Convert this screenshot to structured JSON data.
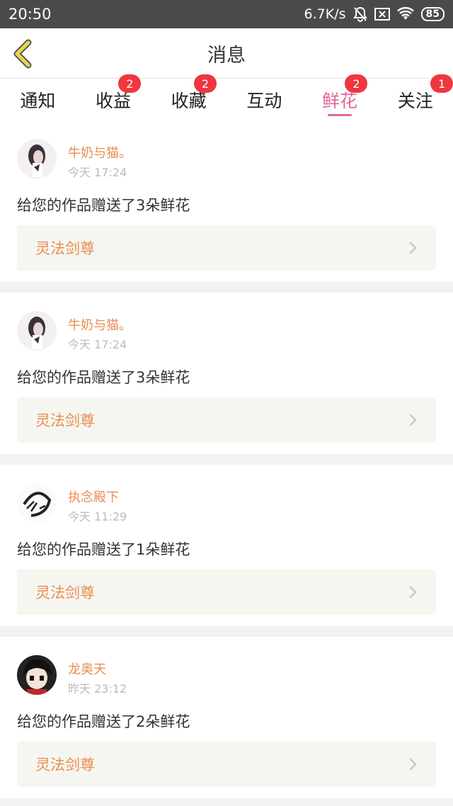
{
  "status_bar": {
    "time": "20:50",
    "network_speed": "6.7K/s",
    "battery": "85",
    "icons": [
      "mute-bell-icon",
      "sim-x-icon",
      "wifi-icon",
      "battery-icon"
    ]
  },
  "header": {
    "title": "消息",
    "back_icon": "chevron-left-icon"
  },
  "tabs": [
    {
      "label": "通知",
      "badge": ""
    },
    {
      "label": "收益",
      "badge": "2"
    },
    {
      "label": "收藏",
      "badge": "2"
    },
    {
      "label": "互动",
      "badge": ""
    },
    {
      "label": "鲜花",
      "badge": "2",
      "active": true
    },
    {
      "label": "关注",
      "badge": "1"
    }
  ],
  "messages": [
    {
      "user": "牛奶与猫。",
      "time": "今天 17:24",
      "text": "给您的作品赠送了3朵鲜花",
      "work": "灵法剑尊"
    },
    {
      "user": "牛奶与猫。",
      "time": "今天 17:24",
      "text": "给您的作品赠送了3朵鲜花",
      "work": "灵法剑尊"
    },
    {
      "user": "执念殿下",
      "time": "今天 11:29",
      "text": "给您的作品赠送了1朵鲜花",
      "work": "灵法剑尊"
    },
    {
      "user": "龙奥天",
      "time": "昨天 23:12",
      "text": "给您的作品赠送了2朵鲜花",
      "work": "灵法剑尊"
    }
  ],
  "colors": {
    "accent": "#e2679a",
    "username": "#e98d52",
    "badge": "#f0363e",
    "back_arrow": "#e8d84a"
  }
}
